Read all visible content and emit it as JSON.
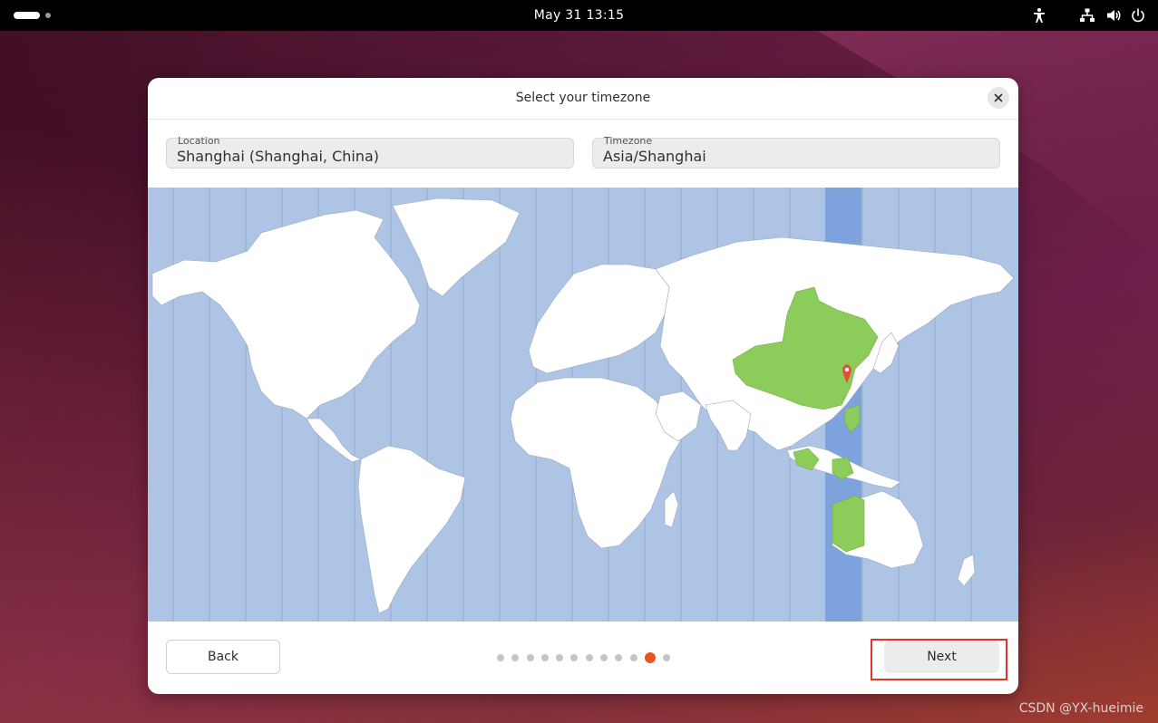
{
  "topbar": {
    "clock": "May 31  13:15",
    "icons": [
      "activities-pill",
      "workspace-dot",
      "accessibility-icon",
      "network-icon",
      "volume-icon",
      "power-icon"
    ]
  },
  "dialog": {
    "title": "Select your timezone",
    "location": {
      "label": "Location",
      "value": "Shanghai (Shanghai, China)"
    },
    "timezone": {
      "label": "Timezone",
      "value": "Asia/Shanghai"
    },
    "map": {
      "highlight_zone": "UTC+08:00",
      "highlight_color": "#8ccc5a",
      "zone_band_color": "#7ea3dc",
      "ocean_color": "#aec4e5",
      "land_color": "#ffffff",
      "pin_color": "#ea4c3b"
    },
    "footer": {
      "back_label": "Back",
      "next_label": "Next",
      "steps_total": 12,
      "current_step": 11
    }
  },
  "accent_color": "#e95420",
  "watermark": "CSDN @YX-hueimie"
}
